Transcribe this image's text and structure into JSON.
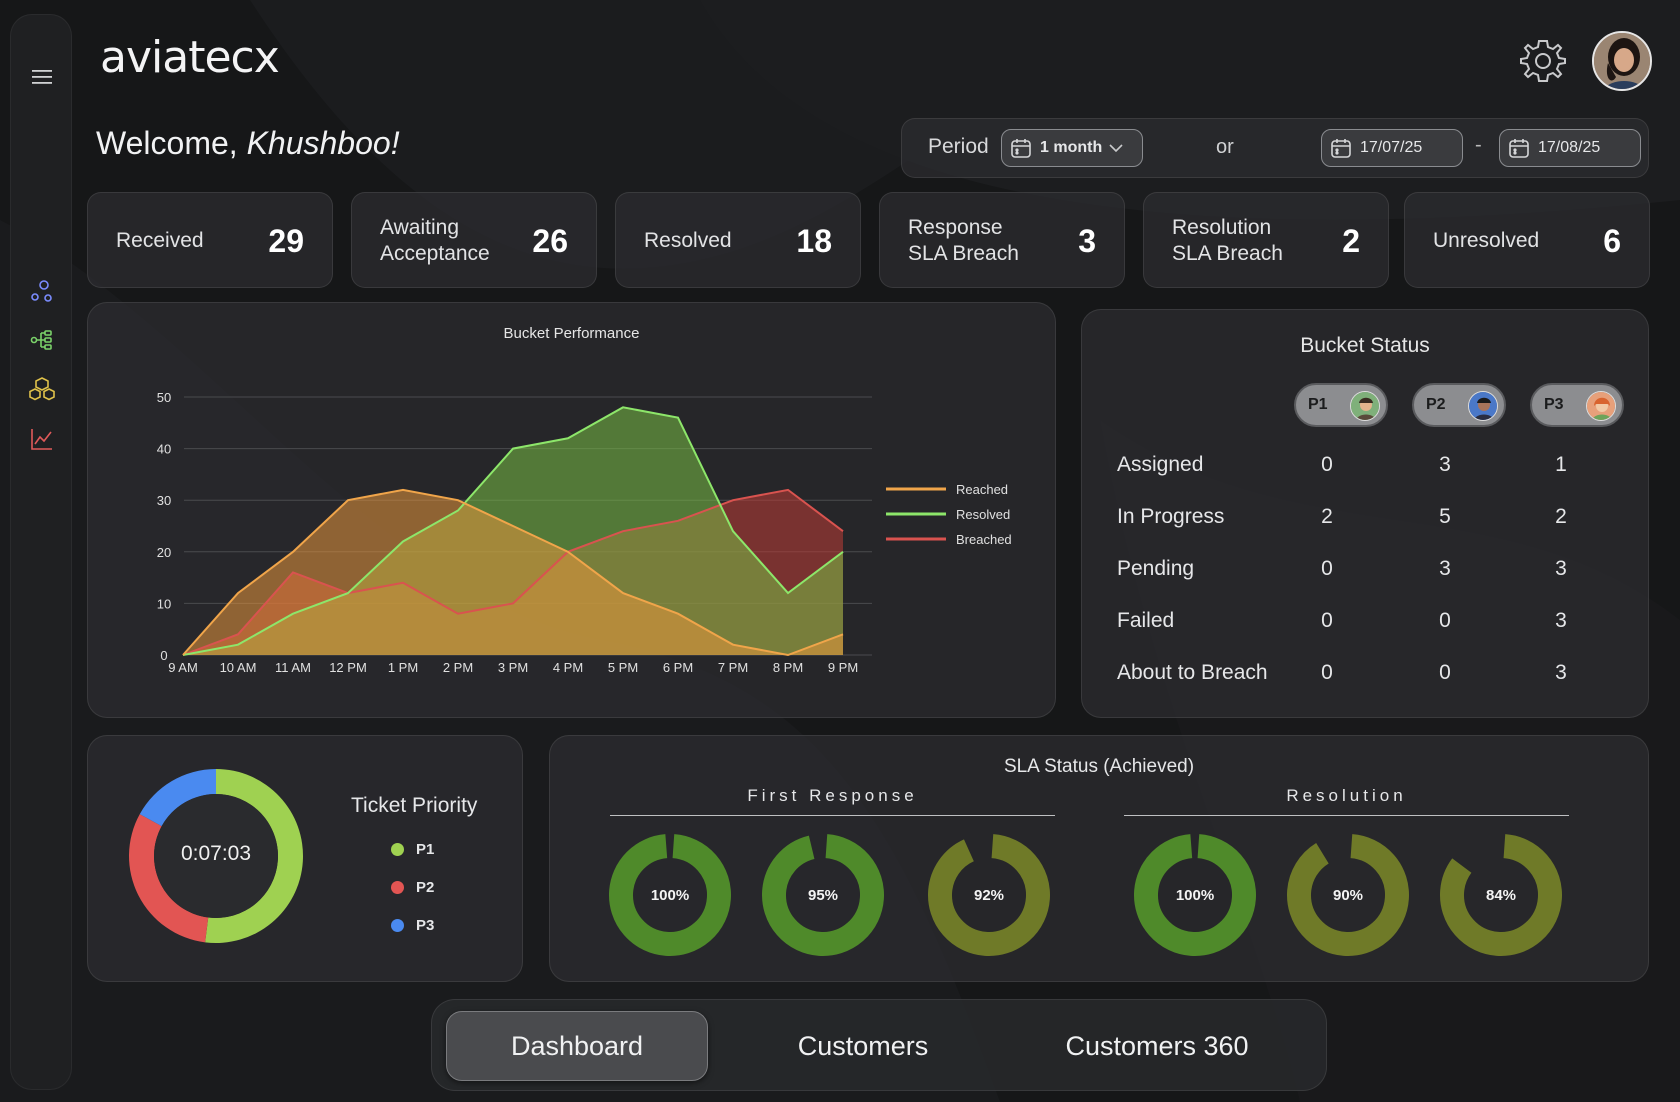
{
  "app": {
    "brand": "aviatecx"
  },
  "header": {
    "welcome_prefix": "Welcome, ",
    "user_name": "Khushboo!",
    "period_label": "Period",
    "period_value": "1 month",
    "or_label": "or",
    "date_from": "17/07/25",
    "date_sep": "-",
    "date_to": "17/08/25"
  },
  "sidebar": {
    "items": [
      {
        "icon": "menu-icon"
      },
      {
        "icon": "nodes-icon",
        "color": "#7b8cff"
      },
      {
        "icon": "hierarchy-icon",
        "color": "#7bd36a"
      },
      {
        "icon": "cubes-icon",
        "color": "#e0c24a"
      },
      {
        "icon": "line-chart-icon",
        "color": "#e05a5a"
      }
    ]
  },
  "stats": [
    {
      "label": "Received",
      "value": "29"
    },
    {
      "label": "Awaiting\nAcceptance",
      "value": "26"
    },
    {
      "label": "Resolved",
      "value": "18"
    },
    {
      "label": "Response\nSLA Breach",
      "value": "3"
    },
    {
      "label": "Resolution\nSLA Breach",
      "value": "2"
    },
    {
      "label": "Unresolved",
      "value": "6"
    }
  ],
  "chart_data": {
    "type": "area",
    "title": "Bucket Performance",
    "x": [
      "9 AM",
      "10 AM",
      "11 AM",
      "12 PM",
      "1 PM",
      "2 PM",
      "3 PM",
      "4 PM",
      "5 PM",
      "6 PM",
      "7 PM",
      "8 PM",
      "9 PM"
    ],
    "ylim": [
      0,
      50
    ],
    "yticks": [
      0,
      10,
      20,
      30,
      40,
      50
    ],
    "grid": true,
    "legend_position": "right",
    "series": [
      {
        "name": "Reached",
        "color": "#f0a54a",
        "values": [
          0,
          12,
          20,
          30,
          32,
          30,
          25,
          20,
          12,
          8,
          2,
          0,
          4
        ]
      },
      {
        "name": "Resolved",
        "color": "#8de66a",
        "values": [
          0,
          2,
          8,
          12,
          22,
          28,
          40,
          42,
          48,
          46,
          24,
          12,
          20
        ]
      },
      {
        "name": "Breached",
        "color": "#d9534f",
        "values": [
          0,
          4,
          16,
          12,
          14,
          8,
          10,
          20,
          24,
          26,
          30,
          32,
          24
        ]
      }
    ]
  },
  "bucket_status": {
    "title": "Bucket Status",
    "columns": [
      "P1",
      "P2",
      "P3"
    ],
    "rows": [
      {
        "label": "Assigned",
        "values": [
          "0",
          "3",
          "1"
        ]
      },
      {
        "label": "In Progress",
        "values": [
          "2",
          "5",
          "2"
        ]
      },
      {
        "label": "Pending",
        "values": [
          "0",
          "3",
          "3"
        ]
      },
      {
        "label": "Failed",
        "values": [
          "0",
          "0",
          "3"
        ]
      },
      {
        "label": "About to Breach",
        "values": [
          "0",
          "0",
          "3"
        ]
      }
    ]
  },
  "ticket_priority": {
    "title": "Ticket Priority",
    "center_value": "0:07:03",
    "slices": [
      {
        "name": "P1",
        "color": "#9fd151",
        "fraction": 0.52
      },
      {
        "name": "P2",
        "color": "#e25553",
        "fraction": 0.31
      },
      {
        "name": "P3",
        "color": "#4a8af0",
        "fraction": 0.17
      }
    ]
  },
  "sla": {
    "title": "SLA Status (Achieved)",
    "first_response_label": "First Response",
    "resolution_label": "Resolution",
    "first_response": [
      {
        "value": 100,
        "label": "100%",
        "color": "#4f8a2a"
      },
      {
        "value": 95,
        "label": "95%",
        "color": "#4f8a2a"
      },
      {
        "value": 92,
        "label": "92%",
        "color": "#6f7a28"
      }
    ],
    "resolution": [
      {
        "value": 100,
        "label": "100%",
        "color": "#4f8a2a"
      },
      {
        "value": 90,
        "label": "90%",
        "color": "#6f7a28"
      },
      {
        "value": 84,
        "label": "84%",
        "color": "#6f7a28"
      }
    ]
  },
  "bottom_nav": {
    "items": [
      {
        "label": "Dashboard",
        "active": true
      },
      {
        "label": "Customers",
        "active": false
      },
      {
        "label": "Customers 360",
        "active": false
      }
    ]
  }
}
